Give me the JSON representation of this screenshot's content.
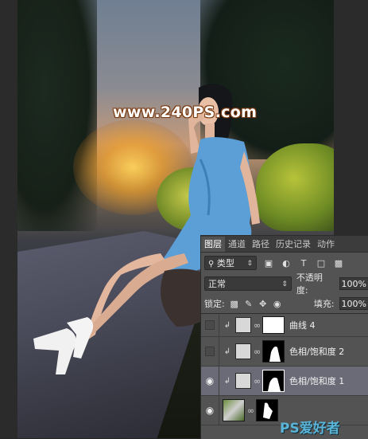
{
  "watermark": "www.240PS.com",
  "layers_panel": {
    "tabs": [
      "图层",
      "通道",
      "路径",
      "历史记录",
      "动作"
    ],
    "active_tab": "图层",
    "filter_select": "类型",
    "blend_mode": "正常",
    "opacity_label": "不透明度:",
    "opacity_value": "100%",
    "lock_label": "锁定:",
    "fill_label": "填充:",
    "fill_value": "100%",
    "layers": [
      {
        "name": "曲线 4",
        "visible": false,
        "mask": "white"
      },
      {
        "name": "色相/饱和度 2",
        "visible": false,
        "mask": "shape"
      },
      {
        "name": "色相/饱和度 1",
        "visible": true,
        "selected": true,
        "mask": "shape"
      },
      {
        "name": "",
        "visible": true,
        "mask": "figure"
      }
    ]
  },
  "ps_logo": "PS爱好者",
  "colors": {
    "panel_bg": "#535353",
    "selected_row": "#6b6b77",
    "tab_bar": "#3c3c3c"
  }
}
